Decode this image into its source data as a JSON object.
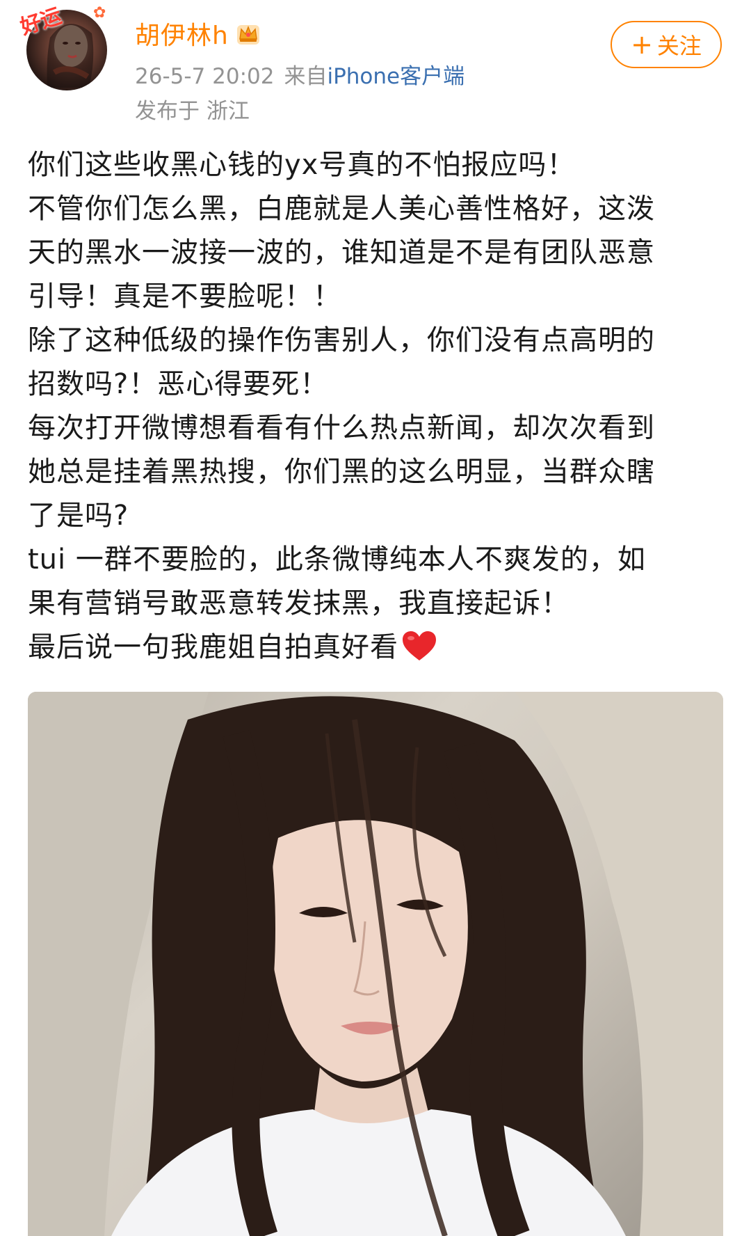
{
  "header": {
    "avatar_badge": "好运",
    "username": "胡伊林h",
    "crown_icon": "crown-icon",
    "post_time": "26-5-7 20:02",
    "source_prefix": "来自",
    "source_app": "iPhone客户端",
    "location": "发布于 浙江",
    "follow_label": "关注",
    "follow_plus": "+",
    "accent_color": "#ff8200"
  },
  "post": {
    "lines": [
      "你们这些收黑心钱的yx号真的不怕报应吗！",
      "不管你们怎么黑，白鹿就是人美心善性格好，这泼",
      "天的黑水一波接一波的，谁知道是不是有团队恶意",
      "引导！真是不要脸呢！！",
      "除了这种低级的操作伤害别人，你们没有点高明的",
      "招数吗?！恶心得要死！",
      "每次打开微博想看看有什么热点新闻，却次次看到",
      "她总是挂着黑热搜，你们黑的这么明显，当群众瞎",
      "了是吗?",
      "tui 一群不要脸的，此条微博纯本人不爽发的，如",
      "果有营销号敢恶意转发抹黑，我直接起诉！",
      "最后说一句我鹿姐自拍真好看"
    ],
    "heart_icon": "heart-icon",
    "heart_color": "#e8262b",
    "image_icon": "selfie-photo"
  }
}
